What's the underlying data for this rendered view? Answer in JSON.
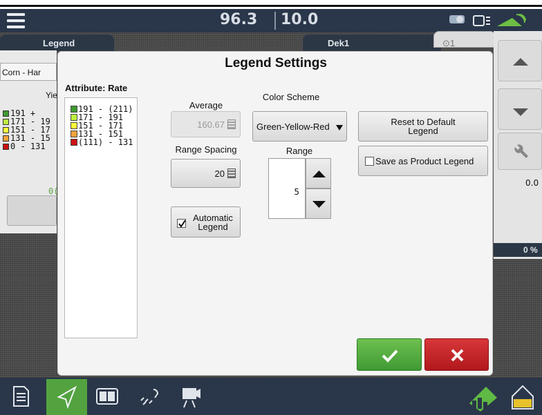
{
  "status": {
    "speed": "96.3",
    "width": "10.0"
  },
  "tabs": {
    "legend": "Legend",
    "dek": "Dek1",
    "right": "⊙1"
  },
  "left_panel": {
    "crop": "Corn - Har",
    "heading": "Yie",
    "items": [
      "191 +",
      "171 - 19",
      "151 - 17",
      "131 - 15",
      "0 - 131"
    ],
    "footer": "0("
  },
  "right_panel": {
    "value1": "0.0",
    "value2": "0 %"
  },
  "dialog": {
    "title": "Legend Settings",
    "attribute_label": "Attribute: Rate",
    "legend_items": [
      {
        "label": "191 - (211)",
        "color": "#3d9a30"
      },
      {
        "label": "171 - 191",
        "color": "#bdf040"
      },
      {
        "label": "151 - 171",
        "color": "#ffff3a"
      },
      {
        "label": "131 - 151",
        "color": "#f5a23a"
      },
      {
        "label": "(111) - 131",
        "color": "#cc1111"
      }
    ],
    "average_label": "Average",
    "average_value": "160.67",
    "range_spacing_label": "Range Spacing",
    "range_spacing_value": "20",
    "automatic_legend_label_1": "Automatic",
    "automatic_legend_label_2": "Legend",
    "automatic_legend_checked": true,
    "color_scheme_label": "Color Scheme",
    "color_scheme_value": "Green-Yellow-Red",
    "range_label": "Range",
    "range_value": "5",
    "reset_label_1": "Reset to Default",
    "reset_label_2": "Legend",
    "save_product_label": "Save as Product Legend",
    "save_product_checked": false
  },
  "colors": {
    "ok": "#4caf3a",
    "cancel": "#c4252a",
    "bar": "#2a3649",
    "active_nav": "#52a33f"
  },
  "icons": [
    "menu-icon",
    "satellite-icon",
    "document-icon",
    "navigation-arrow-icon",
    "split-view-icon",
    "seed-icon",
    "camera-icon",
    "field-icon",
    "home-icon"
  ]
}
